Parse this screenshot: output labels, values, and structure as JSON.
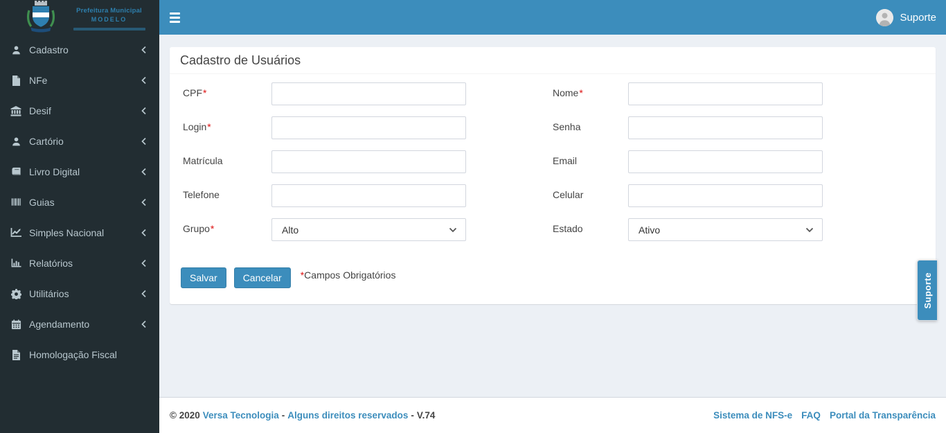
{
  "logo": {
    "line1": "Prefeitura Municipal",
    "line2": "MODELO"
  },
  "topbar": {
    "user_label": "Suporte"
  },
  "sidebar": {
    "items": [
      {
        "label": "Cadastro",
        "icon": "user-icon"
      },
      {
        "label": "NFe",
        "icon": "file-icon"
      },
      {
        "label": "Desif",
        "icon": "bank-icon"
      },
      {
        "label": "Cartório",
        "icon": "user-icon"
      },
      {
        "label": "Livro Digital",
        "icon": "book-icon"
      },
      {
        "label": "Guias",
        "icon": "barcode-icon"
      },
      {
        "label": "Simples Nacional",
        "icon": "line-chart-icon"
      },
      {
        "label": "Relatórios",
        "icon": "bar-chart-icon"
      },
      {
        "label": "Utilitários",
        "icon": "gear-icon"
      },
      {
        "label": "Agendamento",
        "icon": "calendar-icon"
      },
      {
        "label": "Homologação Fiscal",
        "icon": "file-text-icon"
      }
    ]
  },
  "card": {
    "title": "Cadastro de Usuários"
  },
  "form": {
    "left": [
      {
        "label": "CPF",
        "req": "*",
        "value": "",
        "type": "text"
      },
      {
        "label": "Login",
        "req": "*",
        "value": "",
        "type": "text"
      },
      {
        "label": "Matrícula",
        "req": "",
        "value": "",
        "type": "text"
      },
      {
        "label": "Telefone",
        "req": "",
        "value": "",
        "type": "text"
      },
      {
        "label": "Grupo",
        "req": "*",
        "value": "Alto",
        "type": "select"
      }
    ],
    "right": [
      {
        "label": "Nome",
        "req": "*",
        "value": "",
        "type": "text"
      },
      {
        "label": "Senha",
        "req": "",
        "value": "",
        "type": "text"
      },
      {
        "label": "Email",
        "req": "",
        "value": "",
        "type": "text"
      },
      {
        "label": "Celular",
        "req": "",
        "value": "",
        "type": "text"
      },
      {
        "label": "Estado",
        "req": "",
        "value": "Ativo",
        "type": "select"
      }
    ],
    "save_label": "Salvar",
    "cancel_label": "Cancelar",
    "required_mark": "*",
    "required_text": "Campos Obrigatórios"
  },
  "support_tab": {
    "label": "Suporte"
  },
  "footer": {
    "copyright": "© 2020",
    "company": "Versa Tecnologia",
    "sep1": "-",
    "rights": "Alguns direitos reservados",
    "sep2": "-",
    "version": "V.74",
    "links": [
      "Sistema de NFS-e",
      "FAQ",
      "Portal da Transparência"
    ]
  },
  "colors": {
    "primary": "#3c8dbc",
    "primary_dark": "#367fa9",
    "sidebar_bg": "#222d32",
    "sidebar_text": "#b8c7ce",
    "content_bg": "#ecf0f5",
    "required_red": "#dd1111"
  }
}
